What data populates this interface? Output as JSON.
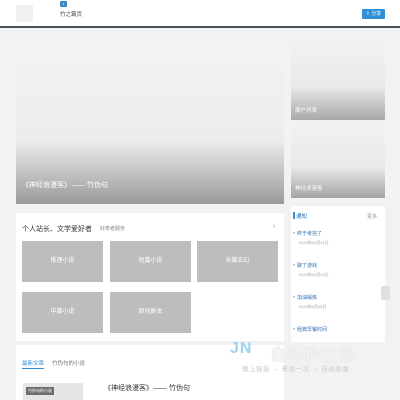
{
  "nav": {
    "home_label": "竹之霸页",
    "badge": "1",
    "share_label": "分享"
  },
  "hero": {
    "caption": "《神经浪漫客》—— 竹伪句"
  },
  "side": {
    "box1_caption": "周户列表",
    "box2_caption": "神经浪漫客"
  },
  "hobby": {
    "title": "个人站长、文学爱好者",
    "tag": "好奇者服务",
    "chevron": "›",
    "categories": [
      "推理小说",
      "短篇小说",
      "长篇玄幻",
      "中篇小说",
      "原创剧本"
    ]
  },
  "notice": {
    "title": "通知",
    "more": "更多",
    "items": [
      {
        "title": "终于考完了",
        "date": "2024年10月21日"
      },
      {
        "title": "聊了游戏",
        "date": "2024年10月12日"
      },
      {
        "title": "加油锻炼",
        "date": "2024年9月18日"
      },
      {
        "title": "经典早餐时间",
        "date": ""
      }
    ]
  },
  "latest": {
    "tab_latest": "最新文章",
    "tab_author": "竹伪句的小说",
    "article_tag": "竹伪句的小说",
    "article_title": "《神经浪漫客》—— 竹伪句"
  },
  "watermark": {
    "logo": "JN",
    "text": "自动秒收录",
    "slogan": "做上链接 → 来访一次 → 自动收录"
  }
}
